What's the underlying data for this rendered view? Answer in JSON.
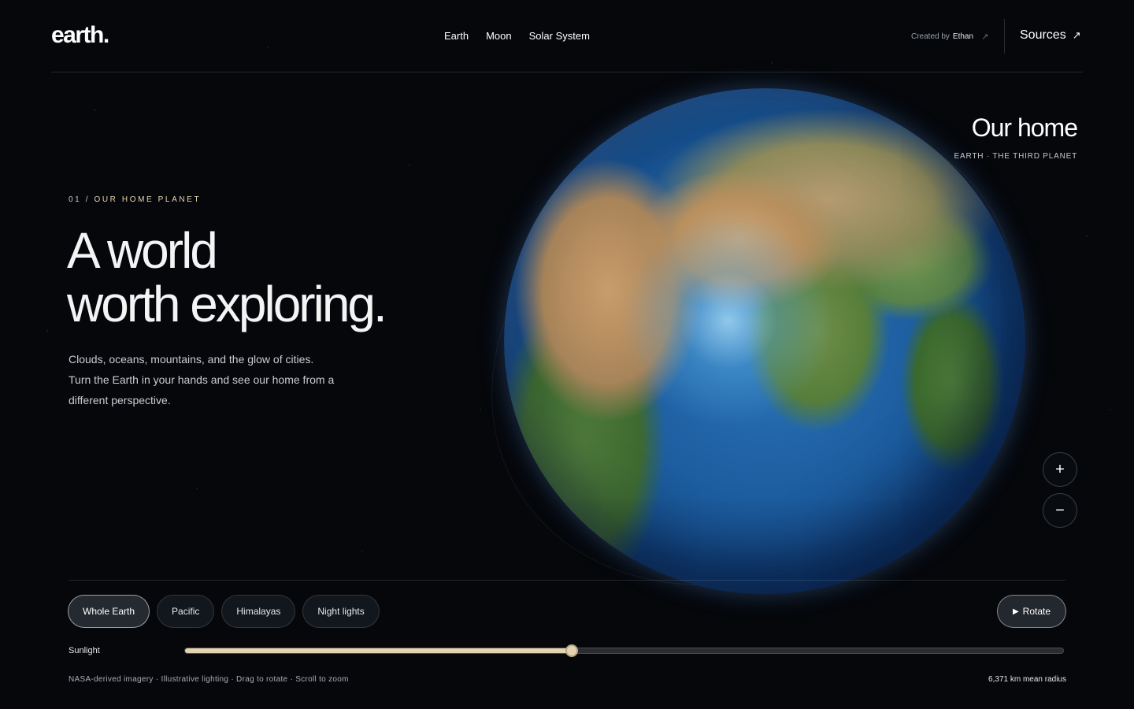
{
  "header": {
    "logo": "earth.",
    "nav": [
      "Earth",
      "Moon",
      "Solar System"
    ],
    "credit_prefix": "Created by",
    "credit_name": "Ethan",
    "credit_arrow": "↗",
    "sources_label": "Sources",
    "sources_arrow": "↗"
  },
  "hero": {
    "eyebrow_num": "01 /",
    "eyebrow_text": "OUR HOME PLANET",
    "headline_line1": "A world",
    "headline_line2": "worth exploring.",
    "lede": "Clouds, oceans, mountains, and the glow of cities. Turn the Earth in your hands and see our home from a different perspective."
  },
  "globe": {
    "title": "Our home",
    "subtitle": "EARTH · THE THIRD PLANET",
    "zoom_in_label": "+",
    "zoom_out_label": "−"
  },
  "controls": {
    "presets": [
      "Whole Earth",
      "Pacific",
      "Himalayas",
      "Night lights"
    ],
    "active_preset": "Whole Earth",
    "rotate_icon": "▶",
    "rotate_label": "Rotate",
    "sunlight_label": "Sunlight",
    "sunlight_value": 0.44,
    "accent_color": "#e4d3b0"
  },
  "footer": {
    "left": "NASA-derived imagery · Illustrative lighting · Drag to rotate · Scroll to zoom",
    "right": "6,371 km mean radius"
  }
}
